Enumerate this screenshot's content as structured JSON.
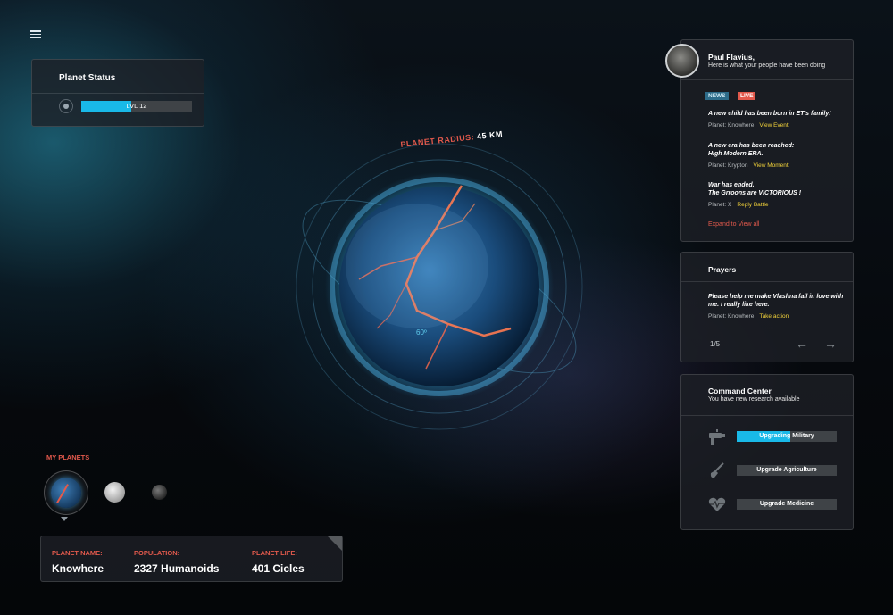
{
  "planet_status": {
    "title": "Planet Status",
    "level_label": "LVL 12",
    "level_progress": 0.45
  },
  "planet": {
    "radius_key": "PLANET RADIUS:",
    "radius_value": "45 KM",
    "degree": "60º"
  },
  "my_planets": {
    "label": "MY PLANETS"
  },
  "info": {
    "name_key": "PLANET NAME:",
    "name_value": "Knowhere",
    "population_key": "POPULATION:",
    "population_value": "2327 Humanoids",
    "life_key": "PLANET LIFE:",
    "life_value": "401 Cicles"
  },
  "news": {
    "greeting": "Paul Flavius,",
    "subtitle": "Here is what your people have been doing",
    "tag_news": "NEWS",
    "tag_live": "LIVE",
    "items": [
      {
        "text": "A new child has been born in ET's family!",
        "planet": "Planet: Knowhere",
        "action": "View Event"
      },
      {
        "text": "A new era has been reached:\nHigh Modern ERA.",
        "planet": "Planet: Krypton",
        "action": "View Moment"
      },
      {
        "text": "War has ended.\nThe Grroons are VICTORIOUS !",
        "planet": "Planet: X",
        "action": "Reply Battle"
      }
    ],
    "expand": "Expand to View all"
  },
  "prayers": {
    "title": "Prayers",
    "text": "Please help me make Vlashna fall in love with me. I really like here.",
    "planet": "Planet: Knowhere",
    "action": "Take action",
    "page": "1/5",
    "prev": "←",
    "next": "→"
  },
  "command": {
    "title": "Command Center",
    "subtitle": "You have new research available",
    "items": [
      {
        "label": "Upgrading Military",
        "icon": "ray-gun-icon",
        "progress": 0.54
      },
      {
        "label": "Upgrade Agriculture",
        "icon": "shovel-icon",
        "progress": 0
      },
      {
        "label": "Upgrade Medicine",
        "icon": "heart-pulse-icon",
        "progress": 0
      }
    ]
  },
  "colors": {
    "accent": "#19b9e8",
    "alert": "#e2594c",
    "action": "#f2d23a"
  }
}
